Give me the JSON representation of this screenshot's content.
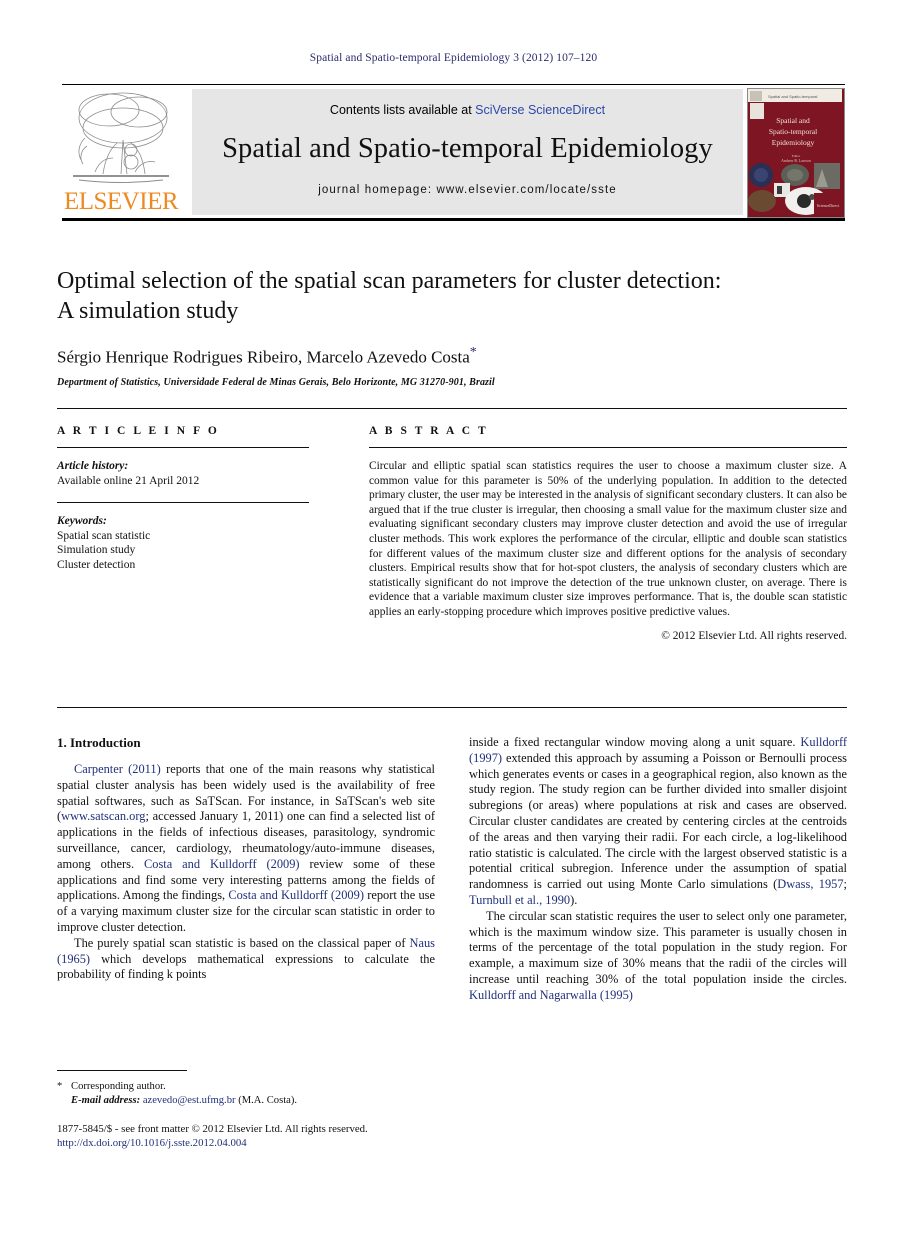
{
  "running_head": "Spatial and Spatio-temporal Epidemiology 3 (2012) 107–120",
  "header": {
    "contents_prefix": "Contents lists available at ",
    "contents_link": "SciVerse ScienceDirect",
    "journal_title": "Spatial and Spatio-temporal Epidemiology",
    "homepage": "journal homepage: www.elsevier.com/locate/sste",
    "publisher_wordmark": "ELSEVIER",
    "cover_title_line1": "Spatial and",
    "cover_title_line2": "Spatio-temporal",
    "cover_title_line3": "Epidemiology",
    "cover_editor_label": "Editor",
    "cover_editor_name": "Andrew B. Lawson"
  },
  "title": {
    "line1": "Optimal selection of the spatial scan parameters for cluster detection:",
    "line2": "A simulation study"
  },
  "authors": {
    "names": "Sérgio Henrique Rodrigues Ribeiro, Marcelo Azevedo Costa",
    "corresponding_marker": "*",
    "affiliation": "Department of Statistics, Universidade Federal de Minas Gerais, Belo Horizonte, MG 31270-901, Brazil"
  },
  "article_info": {
    "heading": "A R T I C L E   I N F O",
    "history_label": "Article history:",
    "history_value": "Available online 21 April 2012",
    "keywords_label": "Keywords:",
    "keywords": [
      "Spatial scan statistic",
      "Simulation study",
      "Cluster detection"
    ]
  },
  "abstract": {
    "heading": "A B S T R A C T",
    "text": "Circular and elliptic spatial scan statistics requires the user to choose a maximum cluster size. A common value for this parameter is 50% of the underlying population. In addition to the detected primary cluster, the user may be interested in the analysis of significant secondary clusters. It can also be argued that if the true cluster is irregular, then choosing a small value for the maximum cluster size and evaluating significant secondary clusters may improve cluster detection and avoid the use of irregular cluster methods. This work explores the performance of the circular, elliptic and double scan statistics for different values of the maximum cluster size and different options for the analysis of secondary clusters. Empirical results show that for hot-spot clusters, the analysis of secondary clusters which are statistically significant do not improve the detection of the true unknown cluster, on average. There is evidence that a variable maximum cluster size improves performance. That is, the double scan statistic applies an early-stopping procedure which improves positive predictive values.",
    "copyright": "© 2012 Elsevier Ltd. All rights reserved."
  },
  "body": {
    "section1_title": "1. Introduction",
    "left": {
      "p1_ref1": "Carpenter (2011)",
      "p1_a": " reports that one of the main reasons why statistical spatial cluster analysis has been widely used is the availability of free spatial softwares, such as SaTScan. For instance, in SaTScan's web site (",
      "p1_link": "www.satscan.org",
      "p1_b": "; accessed January 1, 2011) one can find a selected list of applications in the fields of infectious diseases, parasitology, syndromic surveillance, cancer, cardiology, rheumatology/auto-immune diseases, among others. ",
      "p1_ref2": "Costa and Kulldorff (2009)",
      "p1_c": " review some of these applications and find some very interesting patterns among the fields of applications. Among the findings, ",
      "p1_ref3": "Costa and Kulldorff (2009)",
      "p1_d": " report the use of a varying maximum cluster size for the circular scan statistic in order to improve cluster detection.",
      "p2_a": "The purely spatial scan statistic is based on the classical paper of ",
      "p2_ref1": "Naus (1965)",
      "p2_b": " which develops mathematical expressions to calculate the probability of finding k points"
    },
    "right": {
      "p2_c": "inside a fixed rectangular window moving along a unit square. ",
      "p2_ref2": "Kulldorff (1997)",
      "p2_d": " extended this approach by assuming a Poisson or Bernoulli process which generates events or cases in a geographical region, also known as the study region. The study region can be further divided into smaller disjoint subregions (or areas) where populations at risk and cases are observed. Circular cluster candidates are created by centering circles at the centroids of the areas and then varying their radii. For each circle, a log-likelihood ratio statistic is calculated. The circle with the largest observed statistic is a potential critical subregion. Inference under the assumption of spatial randomness is carried out using Monte Carlo simulations (",
      "p2_ref3": "Dwass, 1957",
      "p2_e": "; ",
      "p2_ref4": "Turnbull et al., 1990",
      "p2_f": ").",
      "p3_a": "The circular scan statistic requires the user to select only one parameter, which is the maximum window size. This parameter is usually chosen in terms of the percentage of the total population in the study region. For example, a maximum size of 30% means that the radii of the circles will increase until reaching 30% of the total population inside the circles. ",
      "p3_ref1": "Kulldorff and Nagarwalla (1995)"
    }
  },
  "footnote": {
    "star": "*",
    "corresponding": "Corresponding author.",
    "email_label": "E-mail address:",
    "email_value": "azevedo@est.ufmg.br",
    "email_owner": "(M.A. Costa)."
  },
  "issn_footer": {
    "line1": "1877-5845/$ - see front matter © 2012 Elsevier Ltd. All rights reserved.",
    "doi": "http://dx.doi.org/10.1016/j.sste.2012.04.004"
  },
  "colors": {
    "link": "#20307a",
    "running_head": "#2b2b70",
    "elsevier_orange": "#ee8a22",
    "cover_red": "#7a1420",
    "header_band_bg": "#e6e6e6"
  }
}
